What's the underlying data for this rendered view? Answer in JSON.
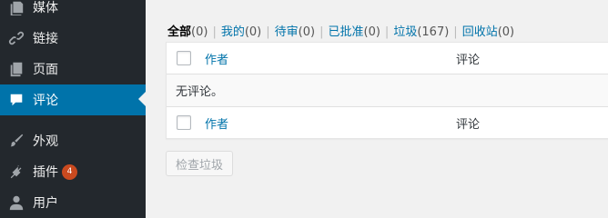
{
  "sidebar": {
    "items": [
      {
        "label": "媒体",
        "icon": "media-icon"
      },
      {
        "label": "链接",
        "icon": "link-icon"
      },
      {
        "label": "页面",
        "icon": "page-icon"
      },
      {
        "label": "评论",
        "icon": "comment-icon",
        "current": true
      },
      {
        "label": "外观",
        "icon": "paintbrush-icon"
      },
      {
        "label": "插件",
        "icon": "plugin-icon",
        "badge": "4"
      },
      {
        "label": "用户",
        "icon": "user-icon"
      }
    ]
  },
  "filters": [
    {
      "label": "全部",
      "count": "(0)"
    },
    {
      "label": "我的",
      "count": "(0)"
    },
    {
      "label": "待审",
      "count": "(0)"
    },
    {
      "label": "已批准",
      "count": "(0)"
    },
    {
      "label": "垃圾",
      "count": "(167)"
    },
    {
      "label": "回收站",
      "count": "(0)"
    }
  ],
  "table": {
    "col_author": "作者",
    "col_comment": "评论",
    "empty_message": "无评论。"
  },
  "actions": {
    "empty_spam_label": "检查垃圾"
  },
  "colors": {
    "sidebar_bg": "#23282d",
    "accent": "#0073aa",
    "badge": "#ca4a1f"
  }
}
